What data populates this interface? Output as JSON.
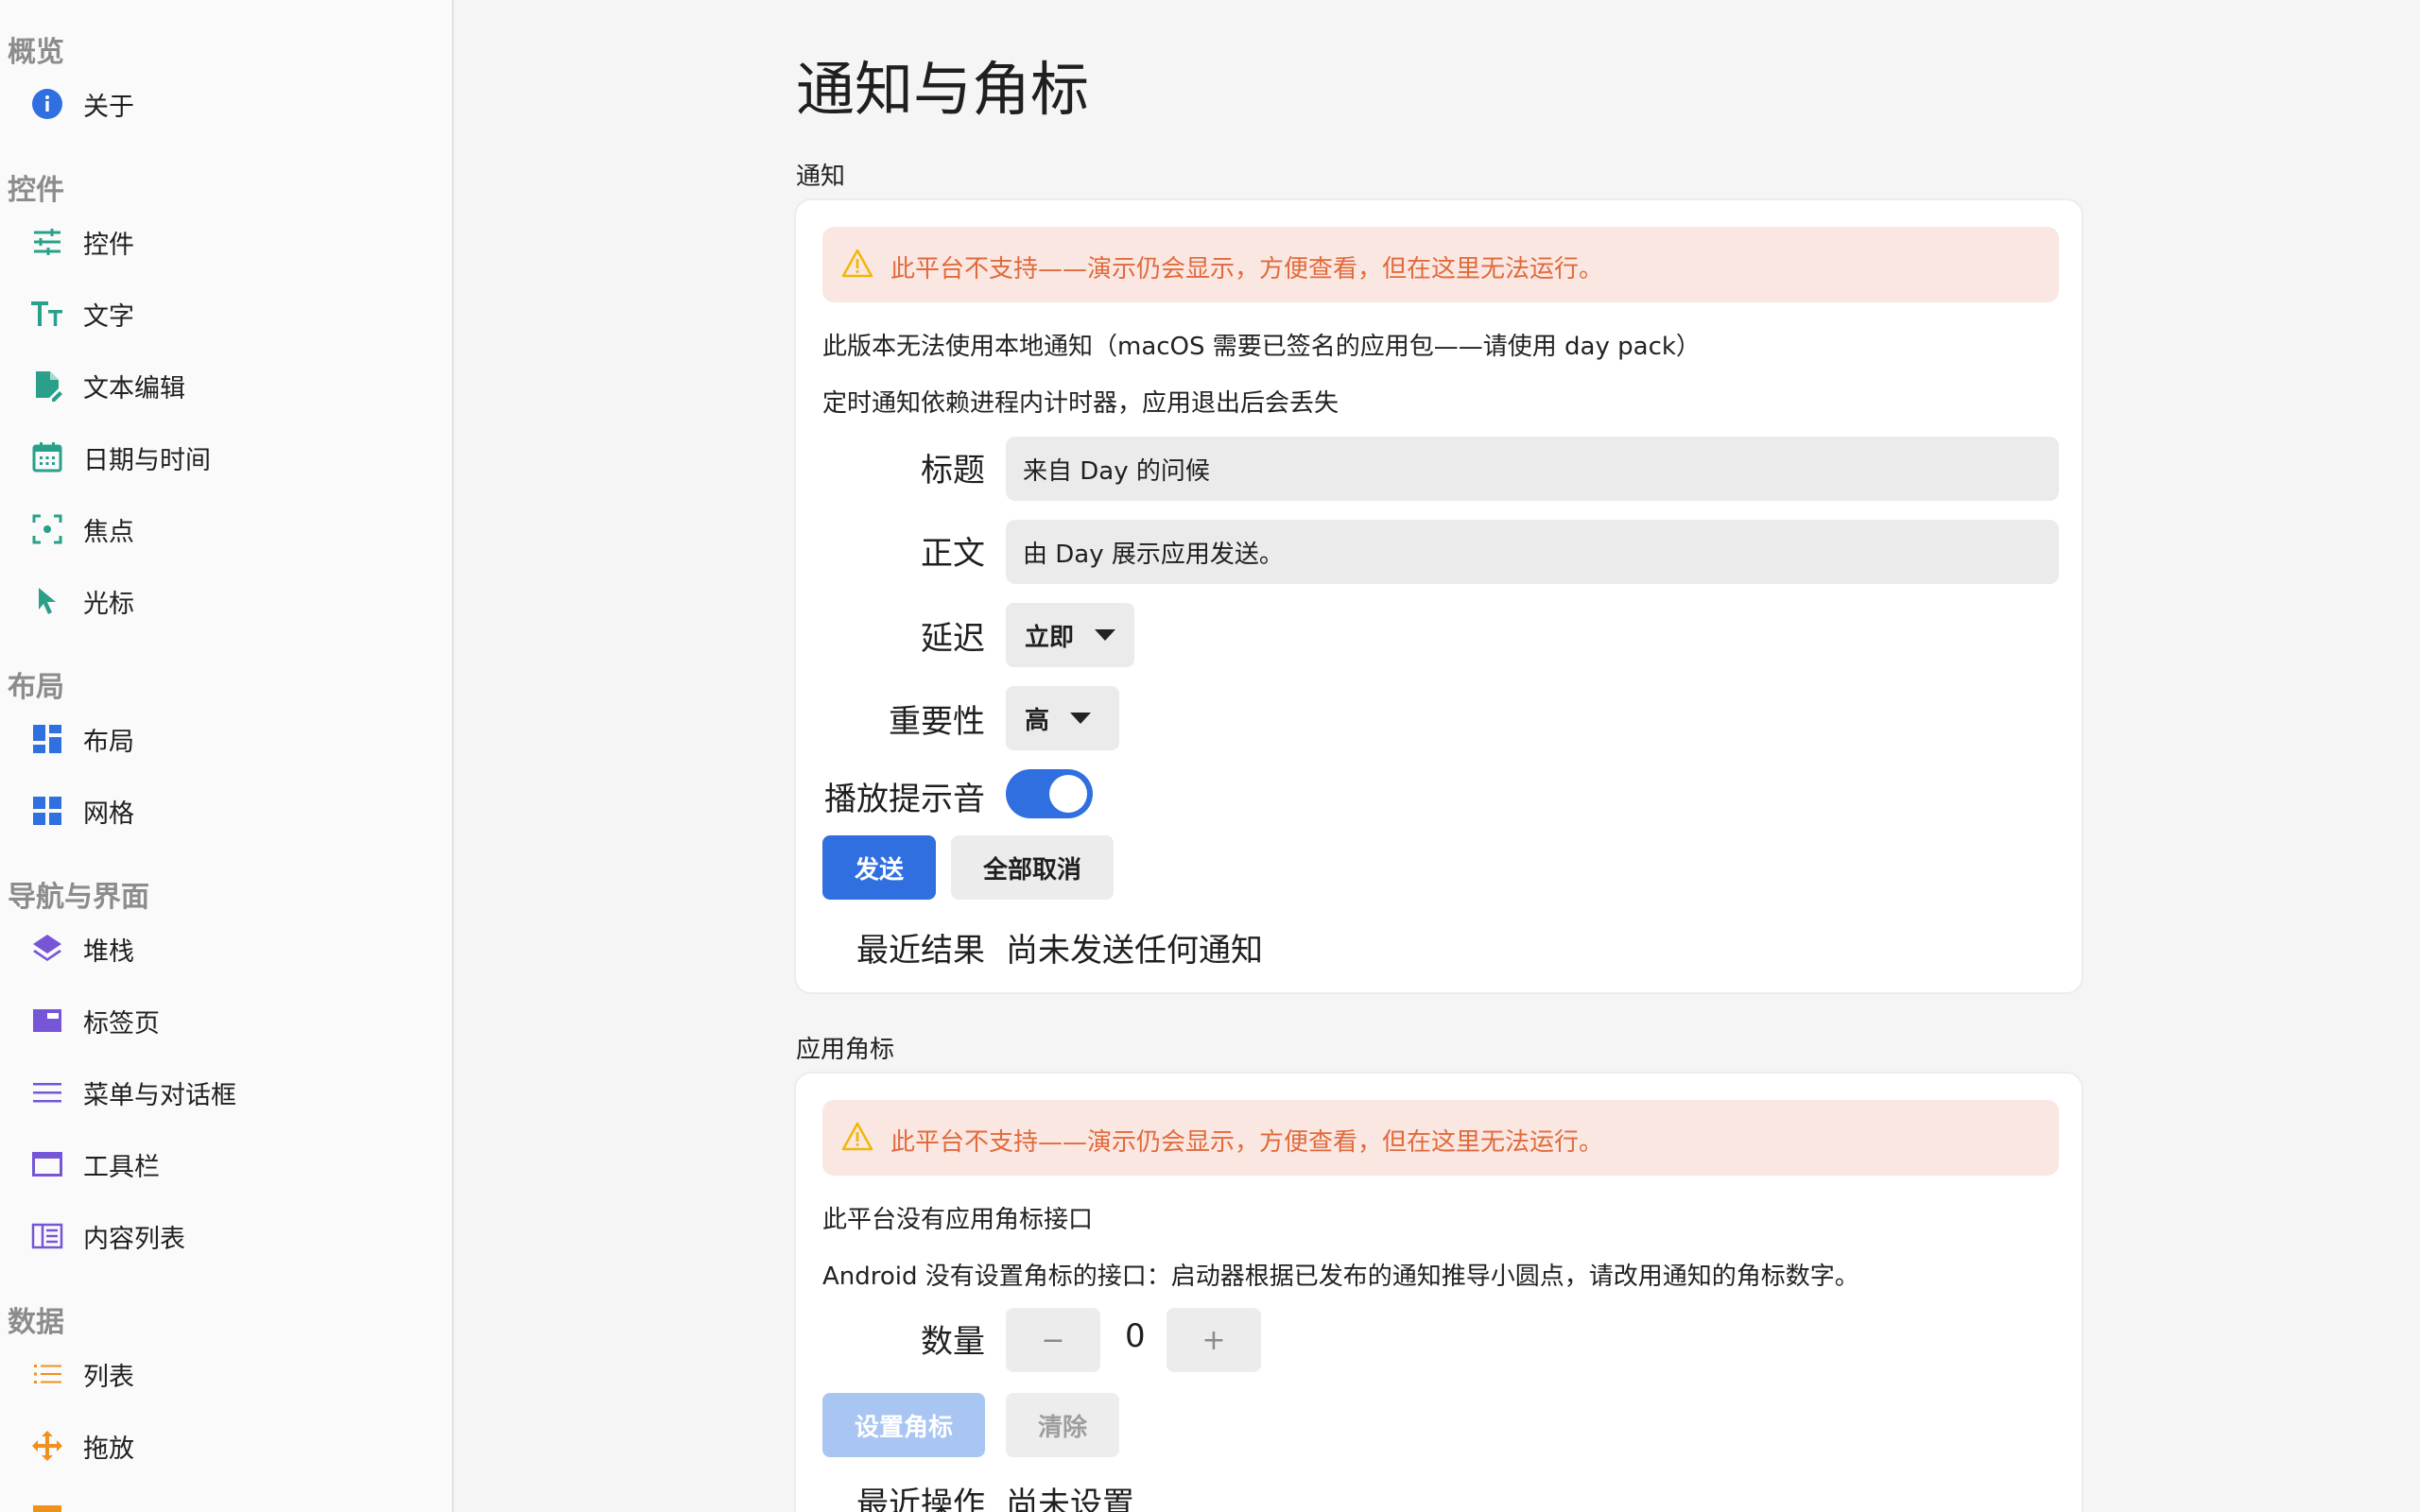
{
  "sidebar": {
    "sections": [
      {
        "title": "概览",
        "items": [
          {
            "label": "关于",
            "icon": "info-icon"
          }
        ]
      },
      {
        "title": "控件",
        "items": [
          {
            "label": "控件",
            "icon": "sliders-icon"
          },
          {
            "label": "文字",
            "icon": "text-size-icon"
          },
          {
            "label": "文本编辑",
            "icon": "edit-document-icon"
          },
          {
            "label": "日期与时间",
            "icon": "calendar-icon"
          },
          {
            "label": "焦点",
            "icon": "focus-icon"
          },
          {
            "label": "光标",
            "icon": "cursor-icon"
          }
        ]
      },
      {
        "title": "布局",
        "items": [
          {
            "label": "布局",
            "icon": "dashboard-icon"
          },
          {
            "label": "网格",
            "icon": "grid-icon"
          }
        ]
      },
      {
        "title": "导航与界面",
        "items": [
          {
            "label": "堆栈",
            "icon": "layers-icon"
          },
          {
            "label": "标签页",
            "icon": "tab-icon"
          },
          {
            "label": "菜单与对话框",
            "icon": "menu-icon"
          },
          {
            "label": "工具栏",
            "icon": "window-icon"
          },
          {
            "label": "内容列表",
            "icon": "columns-icon"
          }
        ]
      },
      {
        "title": "数据",
        "items": [
          {
            "label": "列表",
            "icon": "list-icon"
          },
          {
            "label": "拖放",
            "icon": "move-icon"
          },
          {
            "label": "",
            "icon": "table-icon"
          }
        ]
      }
    ]
  },
  "colors": {
    "accent": "#2f6fe0",
    "warning_bg": "#fbe7e2",
    "warning_text": "#e06a3b",
    "warning_icon": "#f2b705"
  },
  "main": {
    "title": "通知与角标",
    "notification": {
      "group_label": "通知",
      "warning": "此平台不支持——演示仍会显示，方便查看，但在这里无法运行。",
      "desc1": "此版本无法使用本地通知（macOS 需要已签名的应用包——请使用 day pack）",
      "desc2": "定时通知依赖进程内计时器，应用退出后会丢失",
      "title_label": "标题",
      "title_value": "来自 Day 的问候",
      "body_label": "正文",
      "body_value": "由 Day 展示应用发送。",
      "delay_label": "延迟",
      "delay_value": "立即",
      "importance_label": "重要性",
      "importance_value": "高",
      "sound_label": "播放提示音",
      "sound_on": true,
      "send_button": "发送",
      "cancel_all_button": "全部取消",
      "result_label": "最近结果",
      "result_value": "尚未发送任何通知"
    },
    "badge": {
      "group_label": "应用角标",
      "warning": "此平台不支持——演示仍会显示，方便查看，但在这里无法运行。",
      "desc1": "此平台没有应用角标接口",
      "desc2": "Android 没有设置角标的接口：启动器根据已发布的通知推导小圆点，请改用通知的角标数字。",
      "count_label": "数量",
      "count_value": "0",
      "minus": "−",
      "plus": "+",
      "set_button": "设置角标",
      "clear_button": "清除",
      "last_label": "最近操作",
      "last_value": "尚未设置"
    }
  }
}
